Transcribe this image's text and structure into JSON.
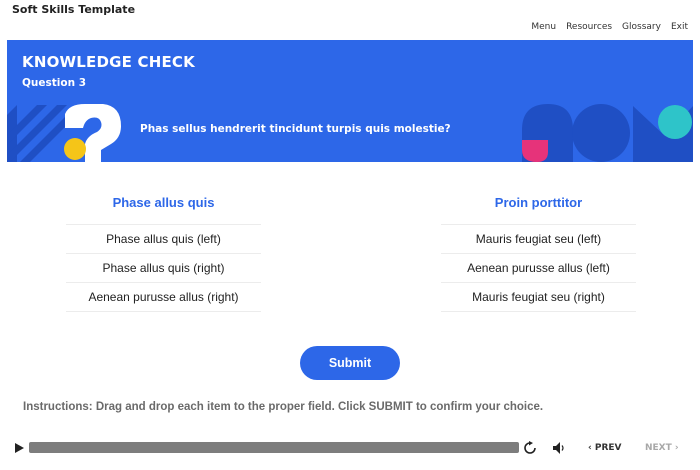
{
  "app": {
    "title": "Soft Skills Template"
  },
  "nav": {
    "menu": "Menu",
    "resources": "Resources",
    "glossary": "Glossary",
    "exit": "Exit"
  },
  "banner": {
    "heading": "KNOWLEDGE CHECK",
    "subheading": "Question 3",
    "question": "Phas sellus hendrerit tincidunt turpis quis molestie?",
    "colors": {
      "background": "#2d67e8",
      "yellow": "#f5c518",
      "pink": "#e6337a",
      "teal": "#2ec4c9",
      "dark_blue": "#1f4fc4"
    }
  },
  "columns": {
    "left": {
      "header": "Phase allus quis",
      "items": [
        "Phase allus quis (left)",
        "Phase allus quis (right)",
        "Aenean purusse allus (right)"
      ]
    },
    "right": {
      "header": "Proin porttitor",
      "items": [
        "Mauris feugiat seu (left)",
        "Aenean purusse allus (left)",
        "Mauris feugiat seu (right)"
      ]
    }
  },
  "submit_label": "Submit",
  "instructions": "Instructions: Drag and drop each item to the proper field. Click SUBMIT to confirm your choice.",
  "player": {
    "prev_label": "PREV",
    "next_label": "NEXT",
    "icons": {
      "play": "play-icon",
      "replay": "replay-icon",
      "volume": "volume-icon",
      "prev": "chevron-left-icon",
      "next": "chevron-right-icon"
    }
  }
}
